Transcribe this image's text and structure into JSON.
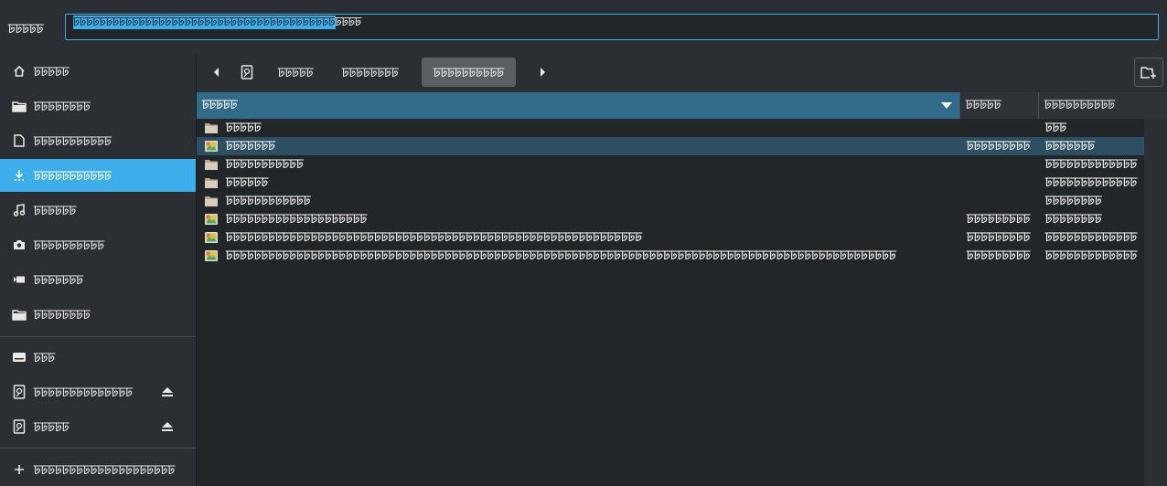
{
  "dialog": {
    "name_label": "ꠓꠓꠓꠓꠓ",
    "name_value_selected": "ꠓꠓꠓꠓꠓꠓꠓꠓꠓꠓꠓꠓꠓꠓꠓꠓꠓꠓꠓꠓꠓꠓꠓꠓꠓꠓꠓꠓꠓꠓꠓꠓꠓꠓꠓꠓꠓꠓꠓꠓ",
    "name_value_rest": "ꠓꠓꠓꠓ"
  },
  "sidebar": {
    "places": [
      {
        "label": "ꠓꠓꠓꠓꠓ",
        "icon": "home-icon"
      },
      {
        "label": "ꠓꠓꠓꠓꠓꠓꠓꠓ",
        "icon": "folder-icon"
      },
      {
        "label": "ꠓꠓꠓꠓꠓꠓꠓꠓꠓꠓꠓ",
        "icon": "document-icon"
      },
      {
        "label": "ꠓꠓꠓꠓꠓꠓꠓꠓꠓꠓꠓ",
        "icon": "download-icon"
      },
      {
        "label": "ꠓꠓꠓꠓꠓꠓ",
        "icon": "music-icon"
      },
      {
        "label": "ꠓꠓꠓꠓꠓꠓꠓꠓꠓꠓ",
        "icon": "camera-icon"
      },
      {
        "label": "ꠓꠓꠓꠓꠓꠓꠓ",
        "icon": "video-icon"
      },
      {
        "label": "ꠓꠓꠓꠓꠓꠓꠓꠓ",
        "icon": "folder-icon"
      }
    ],
    "devices": [
      {
        "label": "ꠓꠓꠓ",
        "icon": "drive-icon"
      },
      {
        "label": "ꠓꠓꠓꠓꠓꠓꠓꠓꠓꠓꠓꠓꠓꠓ",
        "icon": "disk-icon",
        "eject": true
      },
      {
        "label": "ꠓꠓꠓꠓꠓ",
        "icon": "disk-icon",
        "eject": true
      }
    ],
    "other": {
      "label": "ꠓꠓꠓꠓꠓꠓꠓꠓꠓꠓꠓꠓꠓꠓꠓꠓꠓꠓꠓꠓ",
      "icon": "plus-icon"
    }
  },
  "pathbar": {
    "crumbs": [
      "ꠓꠓꠓꠓꠓ",
      "ꠓꠓꠓꠓꠓꠓꠓꠓ",
      "ꠓꠓꠓꠓꠓꠓꠓꠓꠓꠓ"
    ],
    "active_index": 2
  },
  "columns": {
    "name": "ꠓꠓꠓꠓꠓ",
    "size": "ꠓꠓꠓꠓꠓ",
    "modified": "ꠓꠓꠓꠓꠓꠓꠓꠓꠓꠓ"
  },
  "files": [
    {
      "name": "ꠓꠓꠓꠓꠓ",
      "type": "folder",
      "size": "",
      "modified": "ꠓꠓꠓ"
    },
    {
      "name": "ꠓꠓꠓꠓꠓꠓꠓ",
      "type": "image",
      "size": "ꠓꠓꠓꠓꠓꠓꠓꠓꠓ",
      "modified": "ꠓꠓꠓꠓꠓꠓꠓ",
      "selected": true
    },
    {
      "name": "ꠓꠓꠓꠓꠓꠓꠓꠓꠓꠓꠓ",
      "type": "folder",
      "size": "",
      "modified": "ꠓꠓꠓꠓꠓꠓꠓꠓꠓꠓꠓꠓꠓ"
    },
    {
      "name": "ꠓꠓꠓꠓꠓꠓ",
      "type": "folder",
      "size": "",
      "modified": "ꠓꠓꠓꠓꠓꠓꠓꠓꠓꠓꠓꠓꠓ"
    },
    {
      "name": "ꠓꠓꠓꠓꠓꠓꠓꠓꠓꠓꠓꠓ",
      "type": "folder",
      "size": "",
      "modified": "ꠓꠓꠓꠓꠓꠓꠓꠓ"
    },
    {
      "name": "ꠓꠓꠓꠓꠓꠓꠓꠓꠓꠓꠓꠓꠓꠓꠓꠓꠓꠓꠓꠓ",
      "type": "image",
      "size": "ꠓꠓꠓꠓꠓꠓꠓꠓꠓ",
      "modified": "ꠓꠓꠓꠓꠓꠓꠓꠓ"
    },
    {
      "name": "ꠓꠓꠓꠓꠓꠓꠓꠓꠓꠓꠓꠓꠓꠓꠓꠓꠓꠓꠓꠓꠓꠓꠓꠓꠓꠓꠓꠓꠓꠓꠓꠓꠓꠓꠓꠓꠓꠓꠓꠓꠓꠓꠓꠓꠓꠓꠓꠓꠓꠓꠓꠓꠓꠓꠓꠓꠓꠓꠓ",
      "type": "image",
      "size": "ꠓꠓꠓꠓꠓꠓꠓꠓꠓ",
      "modified": "ꠓꠓꠓꠓꠓꠓꠓꠓꠓꠓꠓꠓꠓ"
    },
    {
      "name": "ꠓꠓꠓꠓꠓꠓꠓꠓꠓꠓꠓꠓꠓꠓꠓꠓꠓꠓꠓꠓꠓꠓꠓꠓꠓꠓꠓꠓꠓꠓꠓꠓꠓꠓꠓꠓꠓꠓꠓꠓꠓꠓꠓꠓꠓꠓꠓꠓꠓꠓꠓꠓꠓꠓꠓꠓꠓꠓꠓꠓꠓꠓꠓꠓꠓꠓꠓꠓꠓꠓꠓꠓꠓꠓꠓꠓꠓꠓꠓꠓꠓꠓꠓꠓꠓꠓꠓꠓꠓꠓꠓꠓꠓꠓꠓ",
      "type": "image",
      "size": "ꠓꠓꠓꠓꠓꠓꠓꠓꠓ",
      "modified": "ꠓꠓꠓꠓꠓꠓꠓꠓꠓꠓꠓꠓꠓ"
    }
  ],
  "colors": {
    "accent": "#3daee9",
    "background": "#2b2e33",
    "list_background": "#232629",
    "selected_row": "#2c4f63"
  }
}
